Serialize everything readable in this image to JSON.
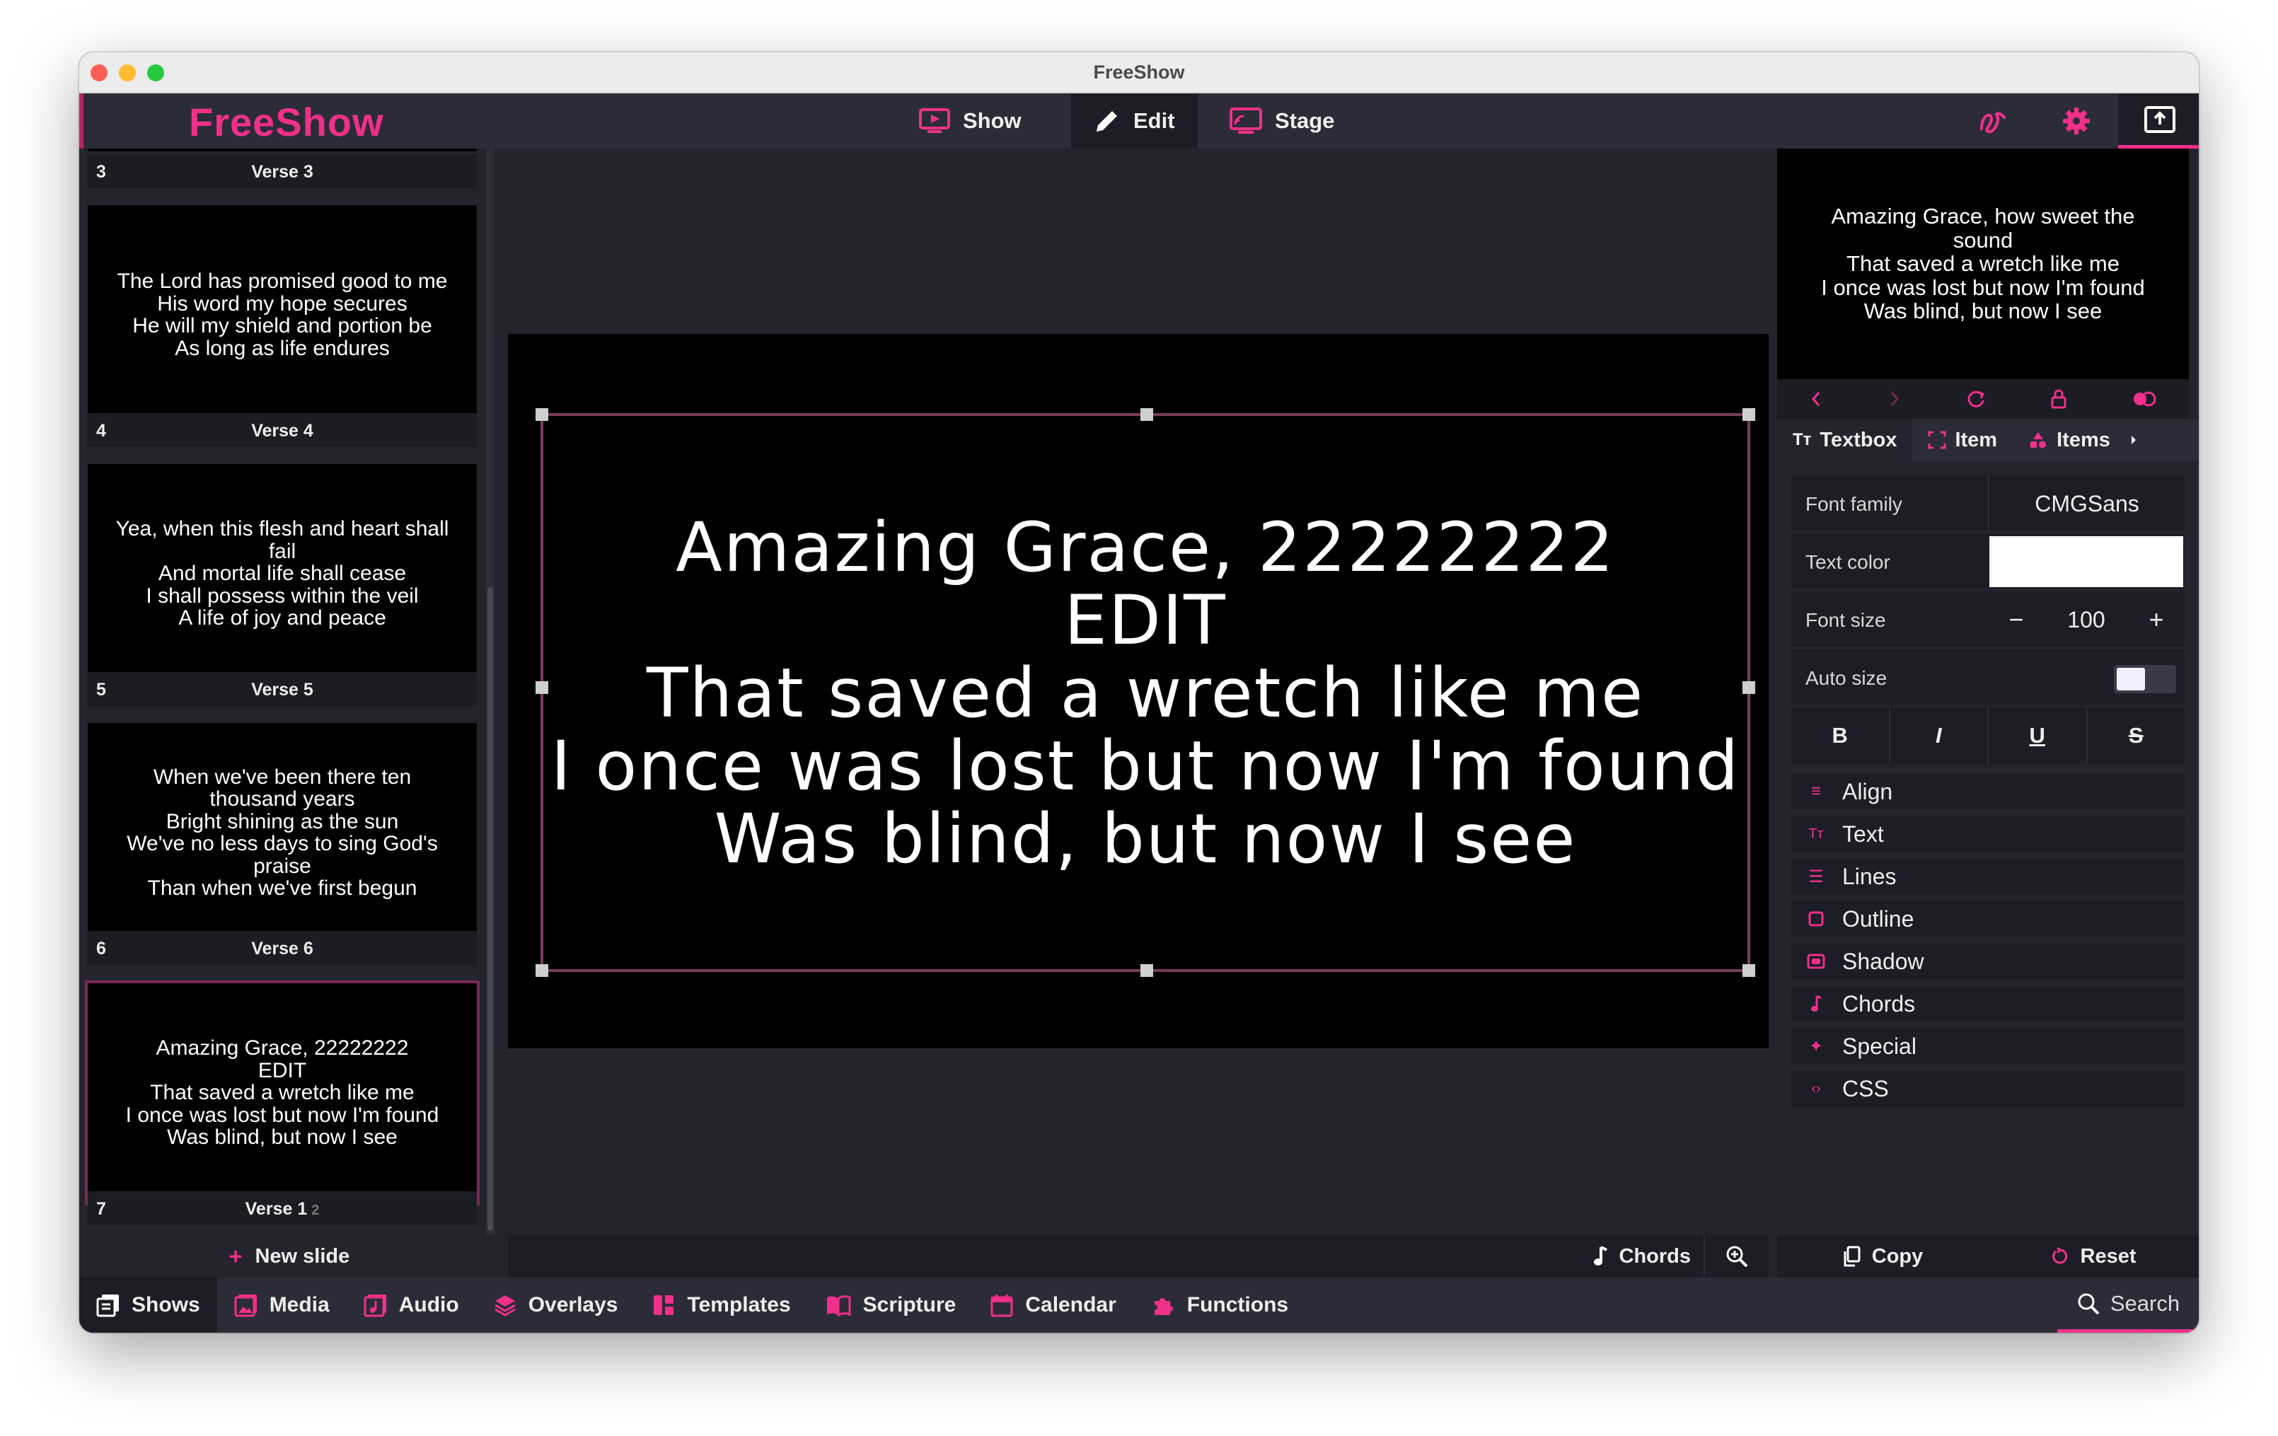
{
  "window": {
    "title": "FreeShow"
  },
  "brand": {
    "name": "FreeShow",
    "accent": "#f0308a"
  },
  "top_tabs": [
    {
      "label": "Show",
      "icon": "show-icon"
    },
    {
      "label": "Edit",
      "icon": "edit-icon",
      "active": true
    },
    {
      "label": "Stage",
      "icon": "stage-icon"
    }
  ],
  "top_right_icons": [
    "drawer-icon",
    "settings-icon",
    "output-icon"
  ],
  "slides": [
    {
      "num": "3",
      "name": "Verse 3",
      "text": ""
    },
    {
      "num": "4",
      "name": "Verse 4",
      "text": "The Lord has promised good to me\nHis word my hope secures\nHe will my shield and portion be\nAs long as life endures"
    },
    {
      "num": "5",
      "name": "Verse 5",
      "text": "Yea, when this flesh and heart shall\nfail\nAnd mortal life shall cease\nI shall possess within the veil\nA life of joy and peace"
    },
    {
      "num": "6",
      "name": "Verse 6",
      "text": "When we've been there ten\nthousand years\nBright shining as the sun\nWe've no less days to sing God's\npraise\nThan when we've first begun"
    },
    {
      "num": "7",
      "name": "Verse 1",
      "badge": "2",
      "text": "Amazing Grace, 22222222\nEDIT\nThat saved a wretch like me\nI once was lost but now I'm found\nWas blind, but now I see",
      "active": true
    }
  ],
  "new_slide": "New slide",
  "editor": {
    "text": "Amazing Grace, 22222222\nEDIT\nThat saved a wretch like me\nI once was lost but now I'm found\nWas blind, but now I see",
    "chords_label": "Chords"
  },
  "preview": {
    "text": "Amazing Grace, how sweet the\nsound\nThat saved a wretch like me\nI once was lost but now I'm found\nWas blind, but now I see"
  },
  "right_tabs": [
    {
      "label": "Textbox",
      "icon": "textbox-icon",
      "active": true
    },
    {
      "label": "Item",
      "icon": "item-icon"
    },
    {
      "label": "Items",
      "icon": "items-icon"
    }
  ],
  "properties": {
    "font_family_label": "Font family",
    "font_family_value": "CMGSans",
    "text_color_label": "Text color",
    "text_color_value": "#ffffff",
    "font_size_label": "Font size",
    "font_size_value": "100",
    "auto_size_label": "Auto size",
    "auto_size_on": false,
    "format_buttons": [
      "B",
      "I",
      "U",
      "S"
    ]
  },
  "sections": [
    "Align",
    "Text",
    "Lines",
    "Outline",
    "Shadow",
    "Chords",
    "Special",
    "CSS"
  ],
  "right_bottom": {
    "copy": "Copy",
    "reset": "Reset"
  },
  "bottom_tabs": [
    {
      "label": "Shows",
      "icon": "shows-icon",
      "active": true
    },
    {
      "label": "Media",
      "icon": "media-icon"
    },
    {
      "label": "Audio",
      "icon": "audio-icon"
    },
    {
      "label": "Overlays",
      "icon": "overlays-icon"
    },
    {
      "label": "Templates",
      "icon": "templates-icon"
    },
    {
      "label": "Scripture",
      "icon": "scripture-icon"
    },
    {
      "label": "Calendar",
      "icon": "calendar-icon"
    },
    {
      "label": "Functions",
      "icon": "functions-icon"
    }
  ],
  "search_label": "Search"
}
